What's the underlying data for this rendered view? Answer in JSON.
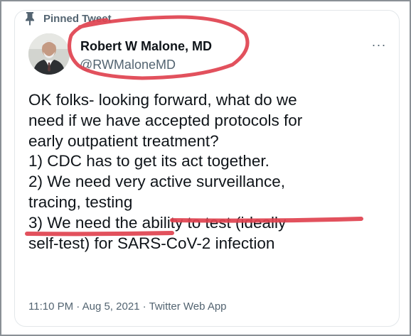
{
  "tweet": {
    "pinned_label": "Pinned Tweet",
    "author_name": "Robert W Malone, MD",
    "author_handle": "@RWMaloneMD",
    "more_label": "···",
    "text": "OK folks- looking forward, what do we\nneed if we have accepted protocols for\nearly outpatient treatment?\n1) CDC has to get its act together.\n2) We need very active surveillance,\ntracing, testing\n3) We need the ability to test (ideally\nself-test) for SARS-CoV-2 infection",
    "time": "11:10 PM",
    "date": "Aug 5, 2021",
    "source": "Twitter Web App",
    "separator": " · "
  },
  "icons": {
    "pin": "pin-icon",
    "more": "more-icon",
    "avatar": "avatar"
  },
  "colors": {
    "annotation": "#e0424f",
    "muted_text": "#536471",
    "primary_text": "#0f1419"
  }
}
